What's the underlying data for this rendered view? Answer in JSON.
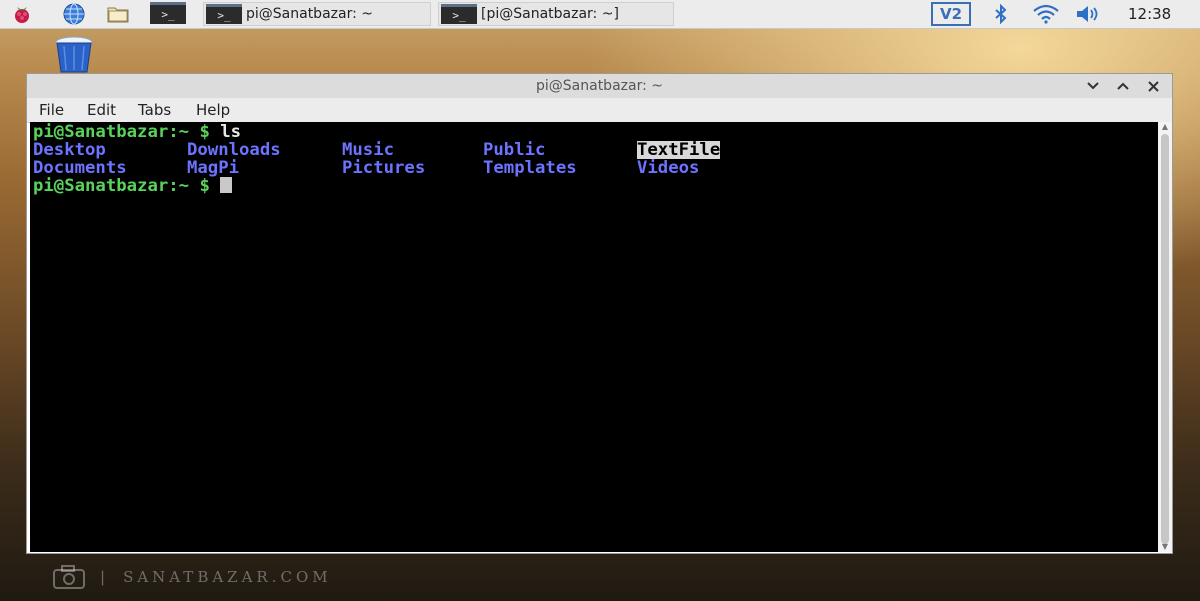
{
  "taskbar": {
    "tasks": [
      {
        "label": "pi@Sanatbazar: ~"
      },
      {
        "label": "[pi@Sanatbazar: ~]"
      }
    ],
    "clock": "12:38",
    "term_glyph": ">_"
  },
  "window": {
    "title": "pi@Sanatbazar: ~",
    "menu": [
      "File",
      "Edit",
      "Tabs",
      "Help"
    ]
  },
  "terminal": {
    "prompt": "pi@Sanatbazar:~ $",
    "command": " ls",
    "row1": [
      "Desktop",
      "Downloads",
      "Music",
      "Public",
      "TextFile"
    ],
    "row2": [
      "Documents",
      "MagPi",
      "Pictures",
      "Templates",
      "Videos"
    ]
  },
  "watermark": {
    "text": "SANATBAZAR.COM"
  },
  "colors": {
    "prompt": "#59d35b",
    "directory": "#6c73ff",
    "terminal_bg": "#000000",
    "highlight_bg": "#d8d8d8"
  }
}
